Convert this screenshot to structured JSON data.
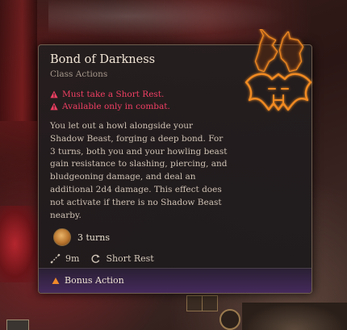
{
  "tooltip": {
    "title": "Bond of Darkness",
    "subtitle": "Class Actions",
    "requirements": [
      "Must take a Short Rest.",
      "Available only in combat."
    ],
    "description": "You let out a howl alongside your Shadow Beast, forging a deep bond. For 3 turns, both you and your howling beast gain resistance to slashing, piercing, and bludgeoning damage, and deal an additional 2d4 damage. This effect does not activate if there is no Shadow Beast nearby.",
    "duration": "3 turns",
    "range": "9m",
    "recharge": "Short Rest",
    "action_cost": "Bonus Action"
  },
  "icons": {
    "emblem": "wolves-bat-emblem-icon",
    "warning": "warning-triangle-icon",
    "duration": "duration-orb-icon",
    "range": "range-icon",
    "recharge": "recharge-icon",
    "action": "bonus-action-triangle-icon"
  },
  "colors": {
    "requirement": "#ef3f62",
    "title": "#f1e6d6",
    "footer": "#452a5c",
    "emblem": "#e8891f"
  }
}
